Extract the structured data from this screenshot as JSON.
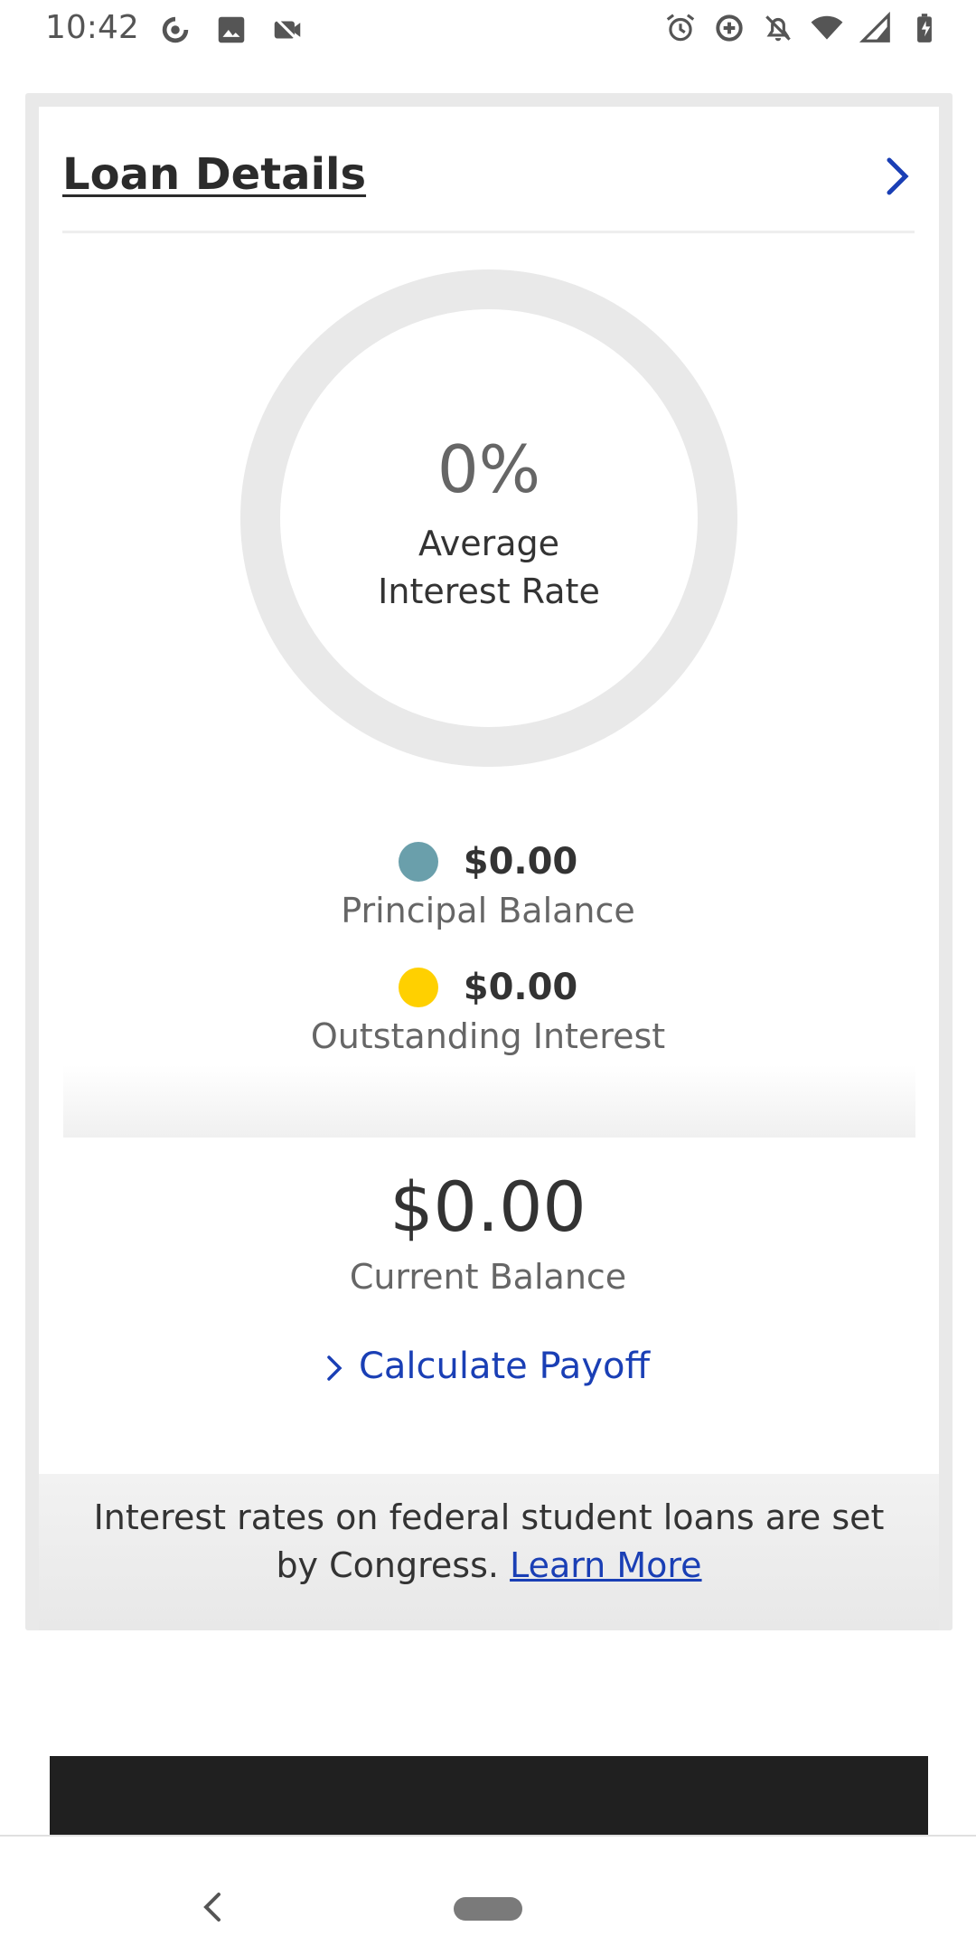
{
  "status_bar": {
    "time": "10:42",
    "left_icons": [
      "at-sign-icon",
      "image-icon",
      "video-off-icon"
    ],
    "right_icons": [
      "alarm-icon",
      "add-circle-icon",
      "notifications-off-icon",
      "wifi-icon",
      "signal-icon",
      "battery-charging-icon"
    ]
  },
  "card": {
    "title": "Loan Details",
    "header_icon": "chevron-right-icon",
    "average_rate": {
      "value": "0%",
      "label_line1": "Average",
      "label_line2": "Interest Rate",
      "progress_fraction": 0
    },
    "legend": [
      {
        "value": "$0.00",
        "label": "Principal Balance",
        "color": "#6a9fab"
      },
      {
        "value": "$0.00",
        "label": "Outstanding Interest",
        "color": "#ffd000"
      }
    ],
    "current_balance": {
      "value": "$0.00",
      "label": "Current Balance"
    },
    "payoff_link": "Calculate Payoff",
    "footer": {
      "text": "Interest rates on federal student loans are set by Congress.",
      "link": "Learn More"
    }
  },
  "colors": {
    "accent_link": "#1a3fb5",
    "donut_track": "#e9e9e9",
    "principal": "#6a9fab",
    "interest": "#ffd000"
  },
  "nav": {
    "back_icon": "back-chevron-icon",
    "home_icon": "home-pill-icon"
  }
}
